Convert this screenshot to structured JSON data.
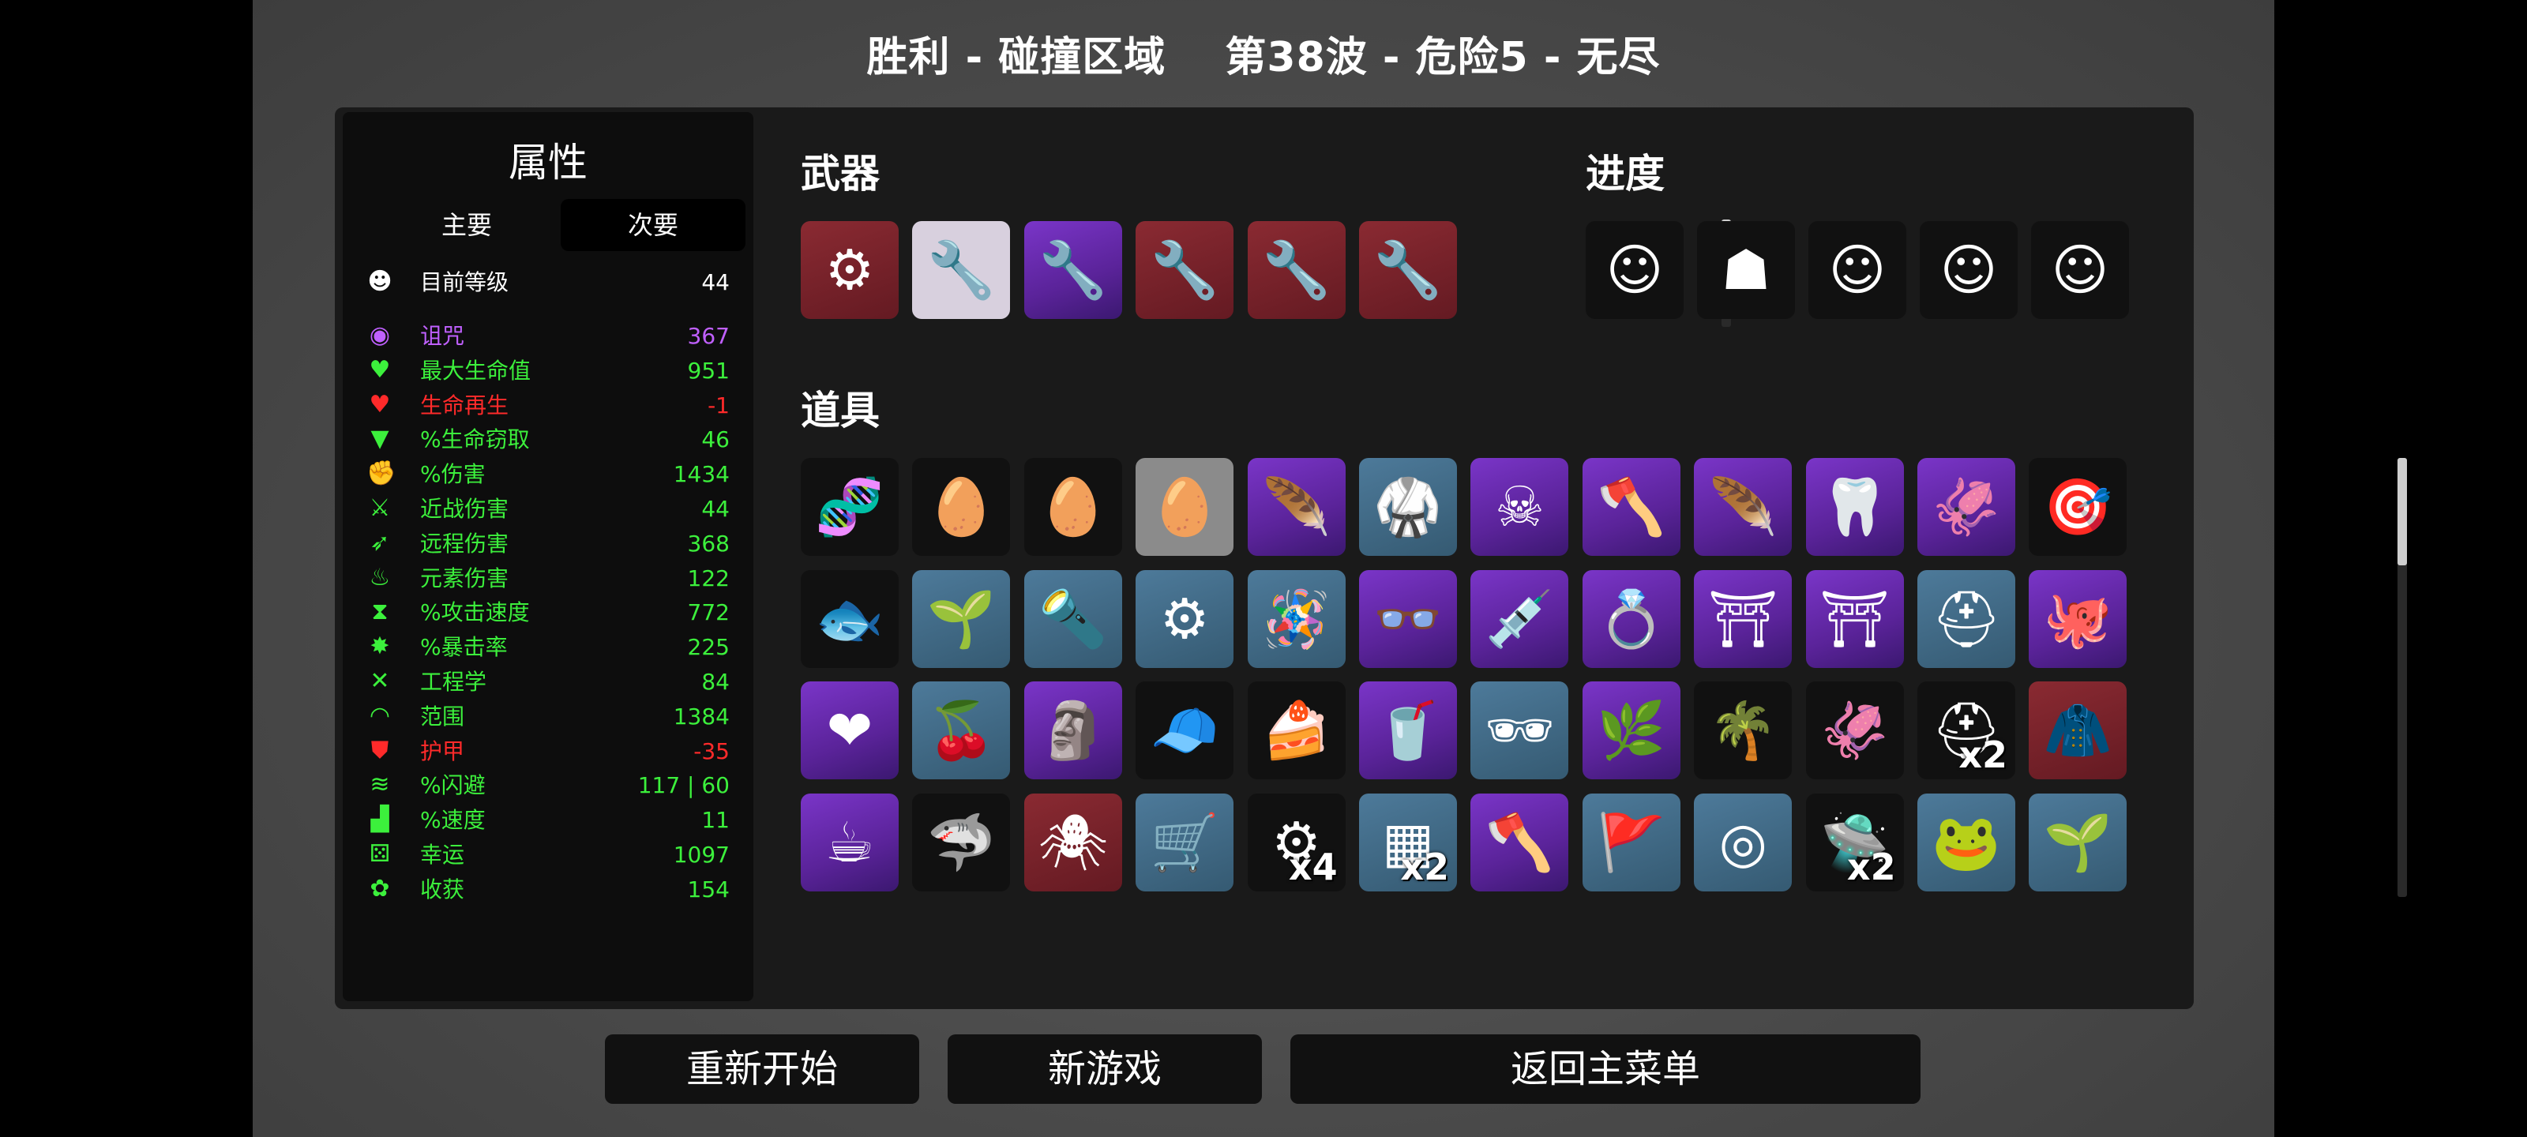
{
  "title": {
    "left": "胜利 - 碰撞区域",
    "right": "第38波 - 危险5 - 无尽"
  },
  "stats": {
    "heading": "属性",
    "tabs": [
      "主要",
      "次要"
    ],
    "rows": [
      {
        "label": "目前等级",
        "value": "44",
        "color": "#ffffff",
        "icon": "level-icon",
        "glyph": "☻"
      },
      {
        "label": "诅咒",
        "value": "367",
        "color": "#c060ff",
        "icon": "curse-eye-icon",
        "glyph": "◉"
      },
      {
        "label": "最大生命值",
        "value": "951",
        "color": "#3cf03c",
        "icon": "heart-icon",
        "glyph": "♥"
      },
      {
        "label": "生命再生",
        "value": "-1",
        "color": "#ff2a2a",
        "icon": "regen-heart-icon",
        "glyph": "♥"
      },
      {
        "label": "%生命窃取",
        "value": "46",
        "color": "#3cf03c",
        "icon": "fangs-icon",
        "glyph": "▼"
      },
      {
        "label": "%伤害",
        "value": "1434",
        "color": "#3cf03c",
        "icon": "fist-icon",
        "glyph": "✊"
      },
      {
        "label": "近战伤害",
        "value": "44",
        "color": "#3cf03c",
        "icon": "sword-icon",
        "glyph": "⚔"
      },
      {
        "label": "远程伤害",
        "value": "368",
        "color": "#3cf03c",
        "icon": "bow-icon",
        "glyph": "➶"
      },
      {
        "label": "元素伤害",
        "value": "122",
        "color": "#3cf03c",
        "icon": "flame-icon",
        "glyph": "♨"
      },
      {
        "label": "%攻击速度",
        "value": "772",
        "color": "#3cf03c",
        "icon": "hourglass-icon",
        "glyph": "⧗"
      },
      {
        "label": "%暴击率",
        "value": "225",
        "color": "#3cf03c",
        "icon": "crit-icon",
        "glyph": "✸"
      },
      {
        "label": "工程学",
        "value": "84",
        "color": "#3cf03c",
        "icon": "wrench-icon",
        "glyph": "✕"
      },
      {
        "label": "范围",
        "value": "1384",
        "color": "#3cf03c",
        "icon": "range-icon",
        "glyph": "◠"
      },
      {
        "label": "护甲",
        "value": "-35",
        "color": "#ff2a2a",
        "icon": "shield-icon",
        "glyph": "⛊"
      },
      {
        "label": "%闪避",
        "value": "117 | 60",
        "color": "#3cf03c",
        "icon": "dodge-icon",
        "glyph": "≋"
      },
      {
        "label": "%速度",
        "value": "11",
        "color": "#3cf03c",
        "icon": "boot-icon",
        "glyph": "▟"
      },
      {
        "label": "幸运",
        "value": "1097",
        "color": "#3cf03c",
        "icon": "dice-icon",
        "glyph": "⚄"
      },
      {
        "label": "收获",
        "value": "154",
        "color": "#3cf03c",
        "icon": "harvest-icon",
        "glyph": "✿"
      }
    ]
  },
  "weapons": {
    "heading": "武器",
    "items": [
      {
        "name": "cannon-weapon-icon",
        "bg": "red",
        "glyph": "⚙"
      },
      {
        "name": "wrench-weapon-icon",
        "bg": "white",
        "glyph": "🔧"
      },
      {
        "name": "wrench-weapon-icon",
        "bg": "purp",
        "glyph": "🔧"
      },
      {
        "name": "wrench-weapon-icon",
        "bg": "red",
        "glyph": "🔧"
      },
      {
        "name": "wrench-weapon-icon",
        "bg": "red",
        "glyph": "🔧"
      },
      {
        "name": "wrench-weapon-icon",
        "bg": "red",
        "glyph": "🔧"
      }
    ]
  },
  "progress": {
    "heading": "进度",
    "items": [
      {
        "name": "gentleman-character-icon",
        "glyph": "☺"
      },
      {
        "name": "knight-character-icon",
        "glyph": "☗"
      },
      {
        "name": "ranger-character-icon",
        "glyph": "☺"
      },
      {
        "name": "egg-character-icon",
        "glyph": "☺"
      },
      {
        "name": "bearded-character-icon",
        "glyph": "☺"
      }
    ]
  },
  "items": {
    "heading": "道具",
    "grid": [
      [
        {
          "name": "dna-icon",
          "bg": "dark",
          "glyph": "🧬"
        },
        {
          "name": "angry-egg-icon",
          "bg": "dark",
          "glyph": "🥚"
        },
        {
          "name": "sleepy-egg-icon",
          "bg": "dark",
          "glyph": "🥚"
        },
        {
          "name": "egg-icon",
          "bg": "gray",
          "glyph": "🥚"
        },
        {
          "name": "feather-icon",
          "bg": "purp",
          "glyph": "🪶"
        },
        {
          "name": "black-belt-icon",
          "bg": "blue",
          "glyph": "🥋"
        },
        {
          "name": "scarecrow-icon",
          "bg": "purp",
          "glyph": "☠"
        },
        {
          "name": "lumberjack-icon",
          "bg": "purp",
          "glyph": "🪓"
        },
        {
          "name": "feather-icon",
          "bg": "purp",
          "glyph": "🪶"
        },
        {
          "name": "broken-tooth-icon",
          "bg": "purp",
          "glyph": "🦷"
        },
        {
          "name": "tentacle-icon",
          "bg": "purp",
          "glyph": "🦑"
        },
        {
          "name": "turret-icon",
          "bg": "dark",
          "glyph": "🎯"
        }
      ],
      [
        {
          "name": "fish-icon",
          "bg": "dark",
          "glyph": "🐟"
        },
        {
          "name": "garden-icon",
          "bg": "blue",
          "glyph": "🌱"
        },
        {
          "name": "flashlight-icon",
          "bg": "blue",
          "glyph": "🔦"
        },
        {
          "name": "gatling-icon",
          "bg": "blue",
          "glyph": "⚙"
        },
        {
          "name": "rattle-icon",
          "bg": "blue",
          "glyph": "🪅"
        },
        {
          "name": "glasses-icon",
          "bg": "purp",
          "glyph": "👓"
        },
        {
          "name": "syringe-icon",
          "bg": "purp",
          "glyph": "💉"
        },
        {
          "name": "ring-icon",
          "bg": "purp",
          "glyph": "💍"
        },
        {
          "name": "structure-icon",
          "bg": "purp",
          "glyph": "⛩"
        },
        {
          "name": "structure-icon",
          "bg": "purp",
          "glyph": "⛩"
        },
        {
          "name": "helmet-icon",
          "bg": "blue",
          "glyph": "⛑"
        },
        {
          "name": "octopus-icon",
          "bg": "purp",
          "glyph": "🐙"
        }
      ],
      [
        {
          "name": "frozen-heart-icon",
          "bg": "purp",
          "glyph": "❤"
        },
        {
          "name": "cherry-bomb-icon",
          "bg": "blue",
          "glyph": "🍒"
        },
        {
          "name": "statue-icon",
          "bg": "purp",
          "glyph": "🗿"
        },
        {
          "name": "propeller-hat-icon",
          "bg": "dark",
          "glyph": "🧢"
        },
        {
          "name": "cake-icon",
          "bg": "dark",
          "glyph": "🍰"
        },
        {
          "name": "lemonade-icon",
          "bg": "purp",
          "glyph": "🥤"
        },
        {
          "name": "sunglasses-icon",
          "bg": "blue",
          "glyph": "🕶"
        },
        {
          "name": "fertilizer-icon",
          "bg": "purp",
          "glyph": "🌿"
        },
        {
          "name": "palm-tree-icon",
          "bg": "dark",
          "glyph": "🌴"
        },
        {
          "name": "tentacle-icon",
          "bg": "dark",
          "glyph": "🦑"
        },
        {
          "name": "helmet-gray-icon",
          "bg": "dark",
          "glyph": "⛑",
          "count": "x2"
        },
        {
          "name": "cape-icon",
          "bg": "red",
          "glyph": "🧥"
        }
      ],
      [
        {
          "name": "coffee-icon",
          "bg": "purp",
          "glyph": "☕"
        },
        {
          "name": "shark-tooth-icon",
          "bg": "dark",
          "glyph": "🦈"
        },
        {
          "name": "spider-icon",
          "bg": "red",
          "glyph": "🕷"
        },
        {
          "name": "wheelbarrow-icon",
          "bg": "blue",
          "glyph": "🛒"
        },
        {
          "name": "scrap-icon",
          "bg": "dark",
          "glyph": "⚙",
          "count": "x4"
        },
        {
          "name": "plank-icon",
          "bg": "blue",
          "glyph": "▦",
          "count": "x2"
        },
        {
          "name": "lumberjack-icon",
          "bg": "purp",
          "glyph": "🪓"
        },
        {
          "name": "banner-icon",
          "bg": "blue",
          "glyph": "🚩"
        },
        {
          "name": "target-icon",
          "bg": "blue",
          "glyph": "◎"
        },
        {
          "name": "ufo-icon",
          "bg": "dark",
          "glyph": "🛸",
          "count": "x2"
        },
        {
          "name": "frog-icon",
          "bg": "blue",
          "glyph": "🐸"
        },
        {
          "name": "garden-icon",
          "bg": "blue",
          "glyph": "🌱"
        }
      ]
    ]
  },
  "buttons": {
    "restart": "重新开始",
    "new_game": "新游戏",
    "main_menu": "返回主菜单"
  }
}
